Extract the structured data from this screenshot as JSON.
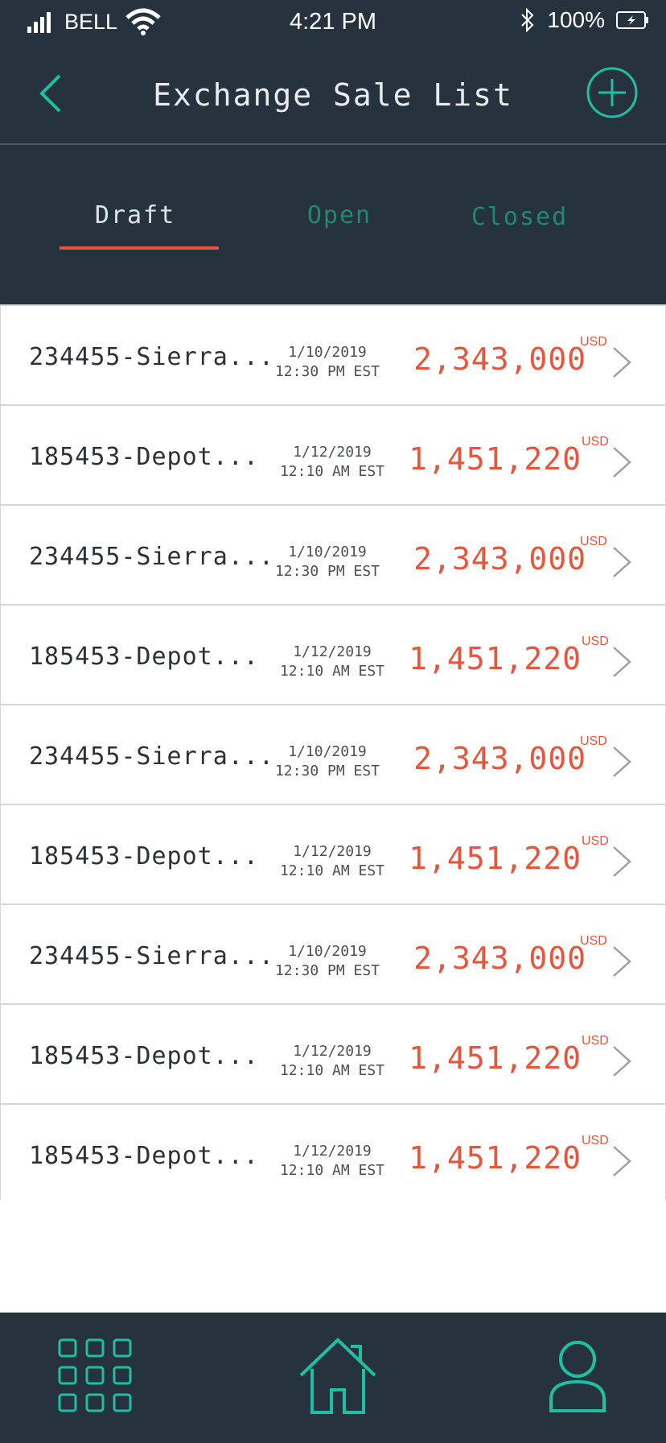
{
  "status": {
    "carrier": "BELL",
    "time": "4:21 PM",
    "battery": "100%"
  },
  "nav": {
    "title": "Exchange Sale List",
    "back_icon": "chevron-left-icon",
    "add_icon": "plus-circle-icon"
  },
  "tabs": [
    {
      "label": "Draft",
      "active": true
    },
    {
      "label": "Open",
      "active": false
    },
    {
      "label": "Closed",
      "active": false
    }
  ],
  "rows": [
    {
      "name": "234455-Sierra...",
      "date": "1/10/2019",
      "time": "12:30 PM EST",
      "amount": "2,343,000",
      "currency": "USD"
    },
    {
      "name": "185453-Depot...",
      "date": "1/12/2019",
      "time": "12:10 AM EST",
      "amount": "1,451,220",
      "currency": "USD"
    },
    {
      "name": "234455-Sierra...",
      "date": "1/10/2019",
      "time": "12:30 PM EST",
      "amount": "2,343,000",
      "currency": "USD"
    },
    {
      "name": "185453-Depot...",
      "date": "1/12/2019",
      "time": "12:10 AM EST",
      "amount": "1,451,220",
      "currency": "USD"
    },
    {
      "name": "234455-Sierra...",
      "date": "1/10/2019",
      "time": "12:30 PM EST",
      "amount": "2,343,000",
      "currency": "USD"
    },
    {
      "name": "185453-Depot...",
      "date": "1/12/2019",
      "time": "12:10 AM EST",
      "amount": "1,451,220",
      "currency": "USD"
    },
    {
      "name": "234455-Sierra...",
      "date": "1/10/2019",
      "time": "12:30 PM EST",
      "amount": "2,343,000",
      "currency": "USD"
    },
    {
      "name": "185453-Depot...",
      "date": "1/12/2019",
      "time": "12:10 AM EST",
      "amount": "1,451,220",
      "currency": "USD"
    },
    {
      "name": "185453-Depot...",
      "date": "1/12/2019",
      "time": "12:10 AM EST",
      "amount": "1,451,220",
      "currency": "USD"
    }
  ],
  "tabbar": {
    "items": [
      "grid-icon",
      "home-icon",
      "user-icon"
    ]
  },
  "colors": {
    "header_bg": "#26333f",
    "accent_teal": "#1fbfa3",
    "amount_red": "#e8553c",
    "tab_inactive": "#1f8a6d"
  }
}
